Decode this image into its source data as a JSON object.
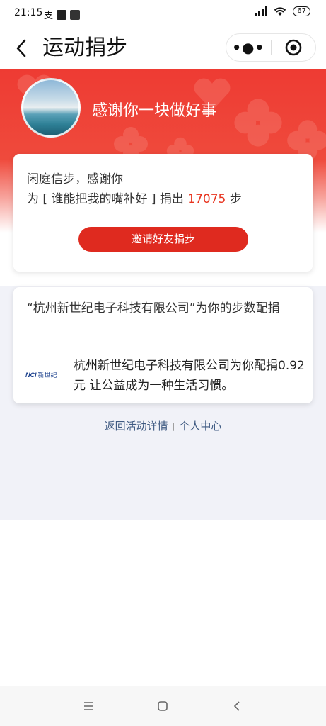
{
  "status_bar": {
    "time": "21:15",
    "battery": "67"
  },
  "nav": {
    "title": "运动捐步",
    "more_label": "•●•"
  },
  "banner": {
    "title": "感谢你一块做好事"
  },
  "thanks_card": {
    "line1": "闲庭信步，感谢你",
    "line2_prefix": "为 [ 谁能把我的嘴补好 ] 捐出 ",
    "steps": "17075",
    "line2_suffix": " 步",
    "invite_button": "邀请好友捐步"
  },
  "sponsor_card": {
    "heading": "“杭州新世纪电子科技有限公司”为你的步数配捐",
    "logo_text": "NCI",
    "logo_cn": "新世纪",
    "text": "杭州新世纪电子科技有限公司为你配捐0.92 元 让公益成为一种生活习惯。"
  },
  "links": {
    "back": "返回活动详情",
    "separator": "|",
    "personal": "个人中心"
  },
  "icons": {
    "back": "chevron-left-icon",
    "close": "target-icon",
    "menu": "menu-icon",
    "home": "square-icon",
    "sys_back": "chevron-left-icon"
  },
  "colors": {
    "brand_red": "#ee3b33",
    "button_red": "#df2a1f",
    "steps_red": "#e8341f",
    "link_blue": "#3f5a82"
  }
}
